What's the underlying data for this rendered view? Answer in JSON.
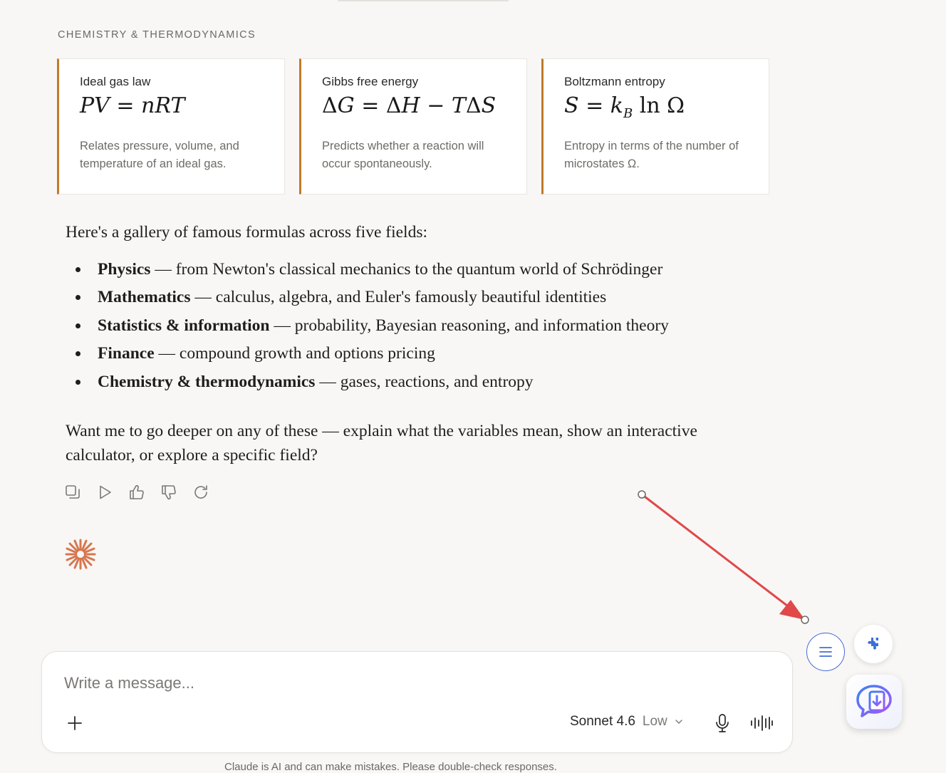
{
  "section_label": "CHEMISTRY & THERMODYNAMICS",
  "cards": [
    {
      "title": "Ideal gas law",
      "desc": "Relates pressure, volume, and temperature of an ideal gas."
    },
    {
      "title": "Gibbs free energy",
      "desc": "Predicts whether a reaction will occur spontaneously."
    },
    {
      "title": "Boltzmann entropy",
      "desc": "Entropy in terms of the number of microstates Ω."
    }
  ],
  "intro": "Here's a gallery of famous formulas across five fields:",
  "bullets": [
    {
      "term": "Physics",
      "text": " — from Newton's classical mechanics to the quantum world of Schrödinger"
    },
    {
      "term": "Mathematics",
      "text": " — calculus, algebra, and Euler's famously beautiful identities"
    },
    {
      "term": "Statistics & information",
      "text": " — probability, Bayesian reasoning, and information theory"
    },
    {
      "term": "Finance",
      "text": " — compound growth and options pricing"
    },
    {
      "term": "Chemistry & thermodynamics",
      "text": " — gases, reactions, and entropy"
    }
  ],
  "closing": "Want me to go deeper on any of these — explain what the variables mean, show an interactive calculator, or explore a specific field?",
  "actions": [
    "copy-icon",
    "play-icon",
    "thumbs-up-icon",
    "thumbs-down-icon",
    "retry-icon"
  ],
  "composer": {
    "placeholder": "Write a message...",
    "model": "Sonnet 4.6",
    "effort": "Low"
  },
  "disclaimer": "Claude is AI and can make mistakes. Please double-check responses.",
  "colors": {
    "accent": "#c07a2c",
    "spark": "#d8764f",
    "annotation": "#e0484a",
    "fab_border": "#4a6bd8"
  }
}
